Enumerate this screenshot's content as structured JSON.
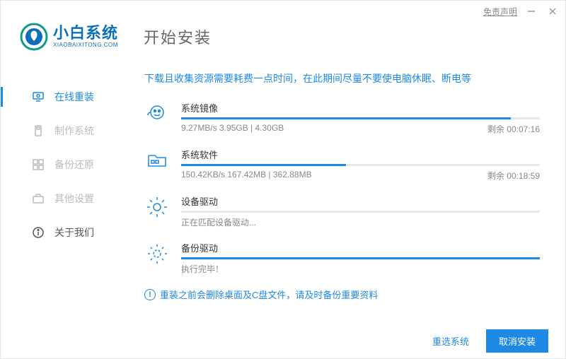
{
  "titlebar": {
    "disclaimer": "免责声明"
  },
  "brand": {
    "cn": "小白系统",
    "en": "XIAOBAIXITONG.COM"
  },
  "page_title": "开始安装",
  "sidebar": {
    "items": [
      {
        "label": "在线重装"
      },
      {
        "label": "制作系统"
      },
      {
        "label": "备份还原"
      },
      {
        "label": "其他设置"
      },
      {
        "label": "关于我们"
      }
    ]
  },
  "hint": "下载且收集资源需要耗费一点时间，在此期间尽量不要使电脑休眠、断电等",
  "tasks": [
    {
      "title": "系统镜像",
      "progress": 92,
      "meta_left": "9.27MB/s 3.95GB | 4.30GB",
      "meta_right": "剩余 00:07:16"
    },
    {
      "title": "系统软件",
      "progress": 46,
      "meta_left": "150.42KB/s 167.42MB | 362.88MB",
      "meta_right": "剩余 00:18:59"
    },
    {
      "title": "设备驱动",
      "progress": 0,
      "meta_left": "正在匹配设备驱动...",
      "meta_right": ""
    },
    {
      "title": "备份驱动",
      "progress": 100,
      "meta_left": "执行完毕！",
      "meta_right": ""
    }
  ],
  "warning": "重装之前会删除桌面及C盘文件，请及时备份重要资料",
  "footer": {
    "reselect": "重选系统",
    "cancel": "取消安装"
  }
}
